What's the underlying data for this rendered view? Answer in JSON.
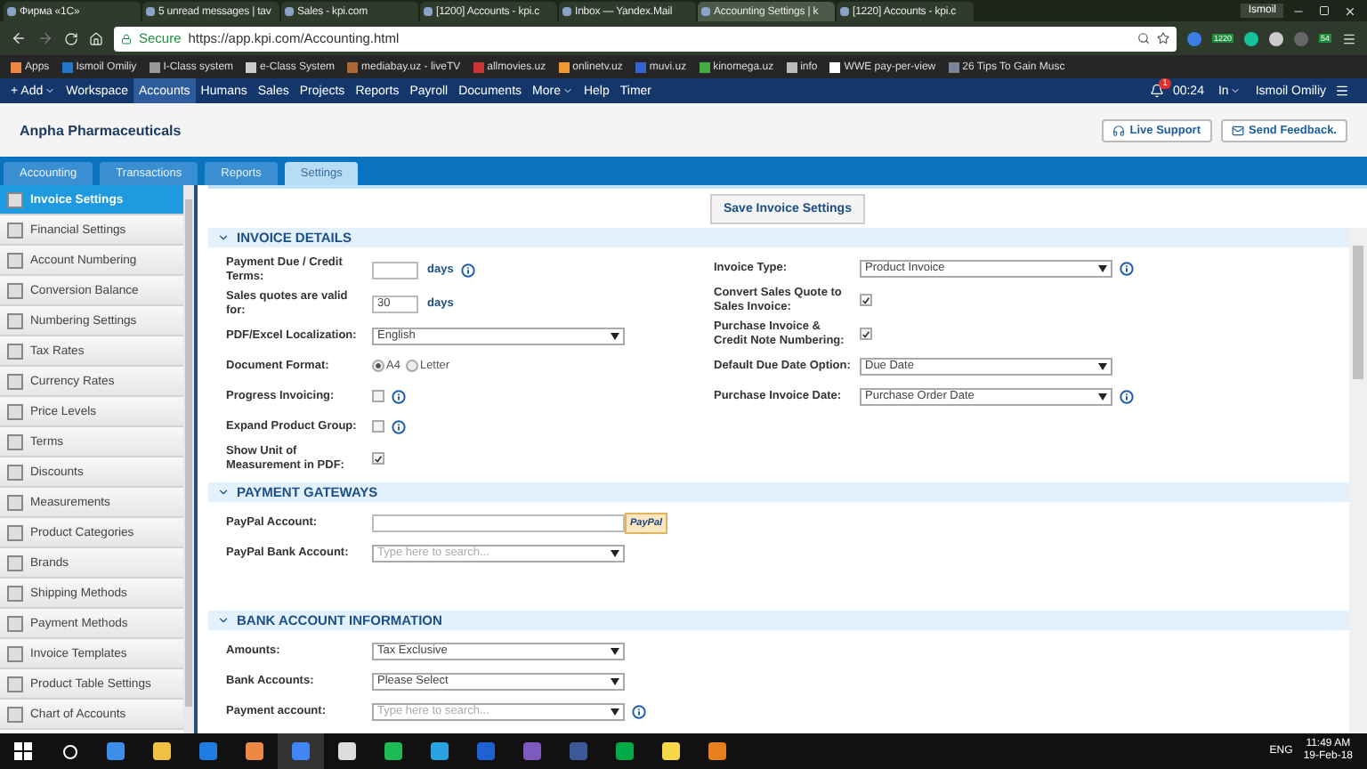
{
  "browser": {
    "tabs": [
      {
        "title": "Фирма «1С»",
        "selected": false
      },
      {
        "title": "5 unread messages | tav",
        "selected": false
      },
      {
        "title": "Sales - kpi.com",
        "selected": false
      },
      {
        "title": "[1200] Accounts - kpi.c",
        "selected": false
      },
      {
        "title": "Inbox — Yandex.Mail",
        "selected": false
      },
      {
        "title": "Accounting Settings | k",
        "selected": true
      },
      {
        "title": "[1220] Accounts - kpi.c",
        "selected": false
      }
    ],
    "profile": "Ismoil",
    "secure": "Secure",
    "url": "https://app.kpi.com/Accounting.html",
    "extension_badges": [
      "1220",
      "54"
    ],
    "bookmarks": [
      "Apps",
      "Ismoil Omiliy",
      "I-Class system",
      "e-Class System",
      "mediabay.uz - liveTV",
      "allmovies.uz",
      "onlinetv.uz",
      "muvi.uz",
      "kinomega.uz",
      "info",
      "WWE pay-per-view",
      "26 Tips To Gain Musc"
    ]
  },
  "app_nav": {
    "items": [
      {
        "label": "+ Add",
        "selected": false,
        "has_menu": true
      },
      {
        "label": "Workspace",
        "selected": false,
        "has_menu": false
      },
      {
        "label": "Accounts",
        "selected": true,
        "has_menu": false
      },
      {
        "label": "Humans",
        "selected": false,
        "has_menu": false
      },
      {
        "label": "Sales",
        "selected": false,
        "has_menu": false
      },
      {
        "label": "Projects",
        "selected": false,
        "has_menu": false
      },
      {
        "label": "Reports",
        "selected": false,
        "has_menu": false
      },
      {
        "label": "Payroll",
        "selected": false,
        "has_menu": false
      },
      {
        "label": "Documents",
        "selected": false,
        "has_menu": false
      },
      {
        "label": "More",
        "selected": false,
        "has_menu": true
      },
      {
        "label": "Help",
        "selected": false,
        "has_menu": false
      },
      {
        "label": "Timer",
        "selected": false,
        "has_menu": false
      }
    ],
    "notification_count": "1",
    "timer": "00:24",
    "status": "In",
    "user": "Ismoil Omiliy"
  },
  "header": {
    "company": "Anpha Pharmaceuticals",
    "buttons": [
      "Live Support",
      "Send Feedback."
    ]
  },
  "module_tabs": [
    {
      "label": "Accounting",
      "selected": false
    },
    {
      "label": "Transactions",
      "selected": false
    },
    {
      "label": "Reports",
      "selected": false
    },
    {
      "label": "Settings",
      "selected": true
    }
  ],
  "sidebar": [
    {
      "label": "Invoice Settings",
      "selected": true
    },
    {
      "label": "Financial Settings",
      "selected": false
    },
    {
      "label": "Account Numbering",
      "selected": false
    },
    {
      "label": "Conversion Balance",
      "selected": false
    },
    {
      "label": "Numbering Settings",
      "selected": false
    },
    {
      "label": "Tax Rates",
      "selected": false
    },
    {
      "label": "Currency Rates",
      "selected": false
    },
    {
      "label": "Price Levels",
      "selected": false
    },
    {
      "label": "Terms",
      "selected": false
    },
    {
      "label": "Discounts",
      "selected": false
    },
    {
      "label": "Measurements",
      "selected": false
    },
    {
      "label": "Product Categories",
      "selected": false
    },
    {
      "label": "Brands",
      "selected": false
    },
    {
      "label": "Shipping Methods",
      "selected": false
    },
    {
      "label": "Payment Methods",
      "selected": false
    },
    {
      "label": "Invoice Templates",
      "selected": false
    },
    {
      "label": "Product Table Settings",
      "selected": false
    },
    {
      "label": "Chart of Accounts",
      "selected": false
    }
  ],
  "save_button": "Save Invoice Settings",
  "sections": [
    {
      "title": "INVOICE DETAILS",
      "columns": [
        [
          {
            "label": "Payment Due / Credit Terms:",
            "kind": "number",
            "unit": "days",
            "info": true
          },
          {
            "label": "Sales quotes are valid for:",
            "kind": "number",
            "value": "30",
            "unit": "days",
            "info": false
          },
          {
            "label": "PDF/Excel Localization:",
            "kind": "select",
            "value": "English",
            "info": false
          },
          {
            "label": "Document Format:",
            "kind": "radio",
            "options": [
              {
                "label": "A4",
                "selected": true
              },
              {
                "label": "Letter",
                "selected": false
              }
            ],
            "info": false
          },
          {
            "label": "Progress Invoicing:",
            "kind": "checkbox",
            "checked": false,
            "info": true
          },
          {
            "label": "Expand Product Group:",
            "kind": "checkbox",
            "checked": false,
            "info": true
          },
          {
            "label": "Show Unit of Measurement in PDF:",
            "kind": "checkbox",
            "checked": true,
            "info": false
          }
        ],
        [
          {
            "label": "Invoice Type:",
            "kind": "select",
            "value": "Product Invoice",
            "info": true
          },
          {
            "label": "Convert Sales Quote to Sales Invoice:",
            "kind": "checkbox",
            "checked": true,
            "info": false
          },
          {
            "label": "Purchase Invoice & Credit Note Numbering:",
            "kind": "checkbox",
            "checked": true,
            "info": false
          },
          {
            "label": "Default Due Date Option:",
            "kind": "select",
            "value": "Due Date",
            "info": false
          },
          {
            "label": "Purchase Invoice Date:",
            "kind": "select",
            "value": "Purchase Order Date",
            "info": true
          }
        ]
      ]
    },
    {
      "title": "PAYMENT GATEWAYS",
      "columns": [
        [
          {
            "label": "PayPal Account:",
            "kind": "paypal",
            "badge": "PayPal",
            "info": false
          },
          {
            "label": "PayPal Bank Account:",
            "kind": "search",
            "placeholder": "Type here to search...",
            "info": false
          }
        ],
        []
      ]
    },
    {
      "title": "BANK ACCOUNT INFORMATION",
      "columns": [
        [
          {
            "label": "Amounts:",
            "kind": "select",
            "value": "Tax Exclusive",
            "info": false
          },
          {
            "label": "Bank Accounts:",
            "kind": "select",
            "value": "Please Select",
            "info": false
          },
          {
            "label": "Payment account:",
            "kind": "search",
            "placeholder": "Type here to search...",
            "info": true
          }
        ],
        []
      ]
    }
  ],
  "taskbar": {
    "language": "ENG",
    "time": "11:49 AM",
    "date": "19-Feb-18"
  }
}
